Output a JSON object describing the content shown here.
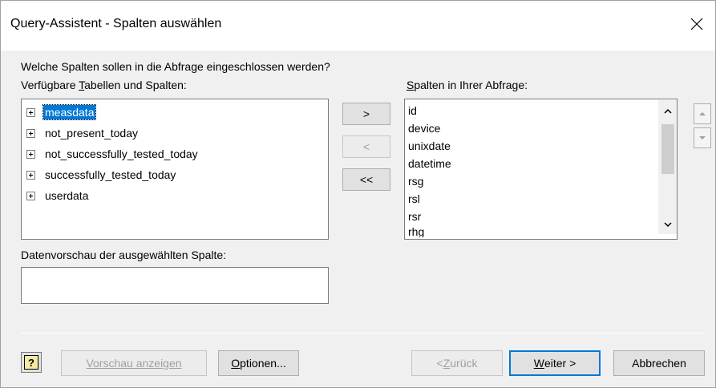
{
  "window": {
    "title": "Query-Assistent - Spalten auswählen",
    "close_glyph": "✕"
  },
  "prompt": "Welche Spalten sollen in die Abfrage eingeschlossen werden?",
  "available": {
    "label_pre": "Verfügbare ",
    "label_key": "T",
    "label_post": "abellen und Spalten:",
    "items": [
      {
        "label": "measdata",
        "selected": true
      },
      {
        "label": "not_present_today",
        "selected": false
      },
      {
        "label": "not_successfully_tested_today",
        "selected": false
      },
      {
        "label": "successfully_tested_today",
        "selected": false
      },
      {
        "label": "userdata",
        "selected": false
      }
    ]
  },
  "transfer": {
    "add": ">",
    "remove": "<",
    "remove_all": "<<"
  },
  "query_columns": {
    "label_key": "S",
    "label_post": "palten in Ihrer Abfrage:",
    "items": [
      "id",
      "device",
      "unixdate",
      "datetime",
      "rsg",
      "rsl",
      "rsr",
      "rhg"
    ]
  },
  "preview": {
    "label": "Datenvorschau der ausgewählten Spalte:",
    "value": ""
  },
  "footer": {
    "help_glyph": "?",
    "preview_button": "Vorschau anzeigen",
    "options_button_key": "O",
    "options_button_post": "ptionen...",
    "back_button_pre": "< ",
    "back_button_key": "Z",
    "back_button_post": "urück",
    "next_button_key": "W",
    "next_button_post": "eiter >",
    "cancel_button": "Abbrechen"
  }
}
